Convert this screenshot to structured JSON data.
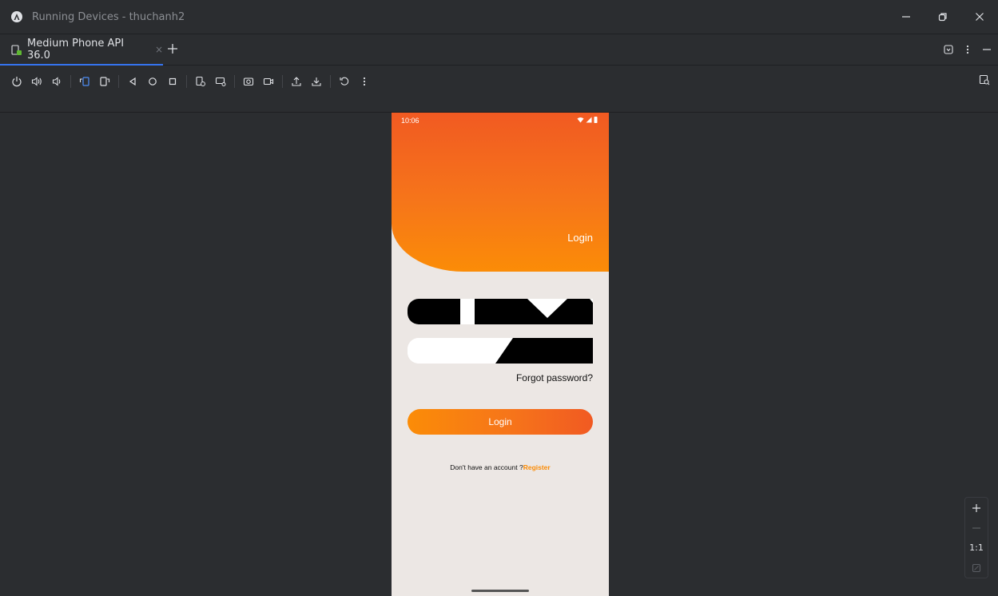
{
  "window": {
    "title": "Running Devices - thuchanh2",
    "app_icon": "android-studio-icon",
    "controls": [
      "minimize-icon",
      "restore-icon",
      "close-icon"
    ]
  },
  "tabs": [
    {
      "label": "Medium Phone API 36.0",
      "icon": "phone-device-icon",
      "close": "×",
      "active": true
    }
  ],
  "tab_add": "+",
  "toolbar": {
    "icons": [
      "power-icon",
      "volume-up-icon",
      "volume-down-icon",
      "rotate-left-icon",
      "rotate-right-icon",
      "back-icon",
      "home-icon",
      "overview-icon",
      "fold-icon",
      "screenshot-device-icon",
      "camera-icon",
      "record-icon",
      "push-icon",
      "pull-icon",
      "reset-icon",
      "more-icon"
    ]
  },
  "phone": {
    "status_time": "10:06",
    "header_title": "Login",
    "forgot_password": "Forgot password?",
    "login_button": "Login",
    "register_prompt": "Don't have an account ?",
    "register_link": "Register",
    "accent_color": "#fb8c07",
    "gradient_start": "#f15a22",
    "gradient_end": "#fb8c07"
  },
  "zoom": {
    "zoom_in": "+",
    "zoom_out": "—",
    "actual_size": "1:1"
  }
}
